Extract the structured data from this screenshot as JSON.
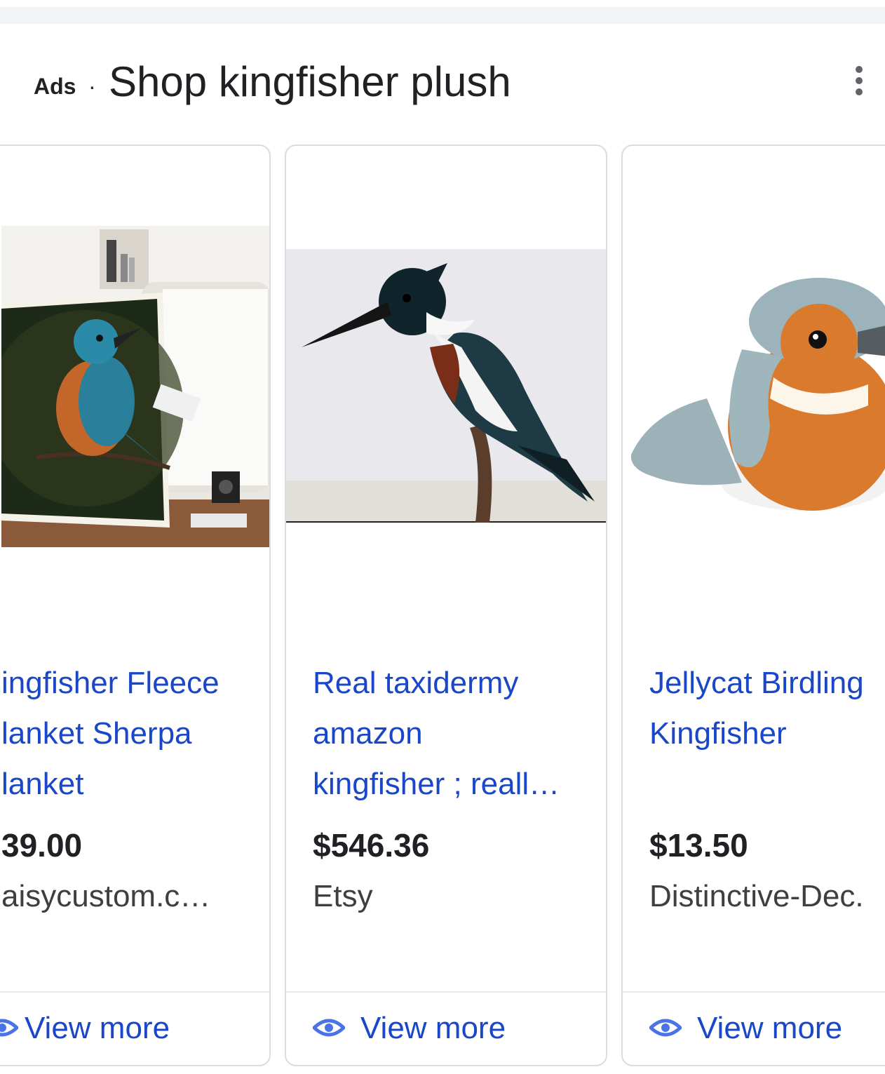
{
  "header": {
    "ads_label": "Ads",
    "separator": "·",
    "title": "Shop kingfisher plush",
    "menu_icon": "more-vert-icon"
  },
  "cards": [
    {
      "title_lines": [
        "ingfisher Fleece",
        "lanket Sherpa",
        "lanket"
      ],
      "price": "39.00",
      "merchant": "aisycustom.c…",
      "view_more": "View more",
      "image": "kingfisher-blanket-on-sofa"
    },
    {
      "title_lines": [
        "Real taxidermy",
        "amazon",
        "kingfisher ; reall…"
      ],
      "price": "$546.36",
      "merchant": "Etsy",
      "view_more": "View more",
      "image": "taxidermy-kingfisher-on-branch"
    },
    {
      "title_lines": [
        "Jellycat Birdling",
        "Kingfisher"
      ],
      "price": "$13.50",
      "merchant": "Distinctive-Dec.",
      "view_more": "View more",
      "image": "plush-kingfisher-toy"
    }
  ],
  "colors": {
    "link": "#1a47c9",
    "text": "#202124",
    "border": "#dadce0"
  }
}
